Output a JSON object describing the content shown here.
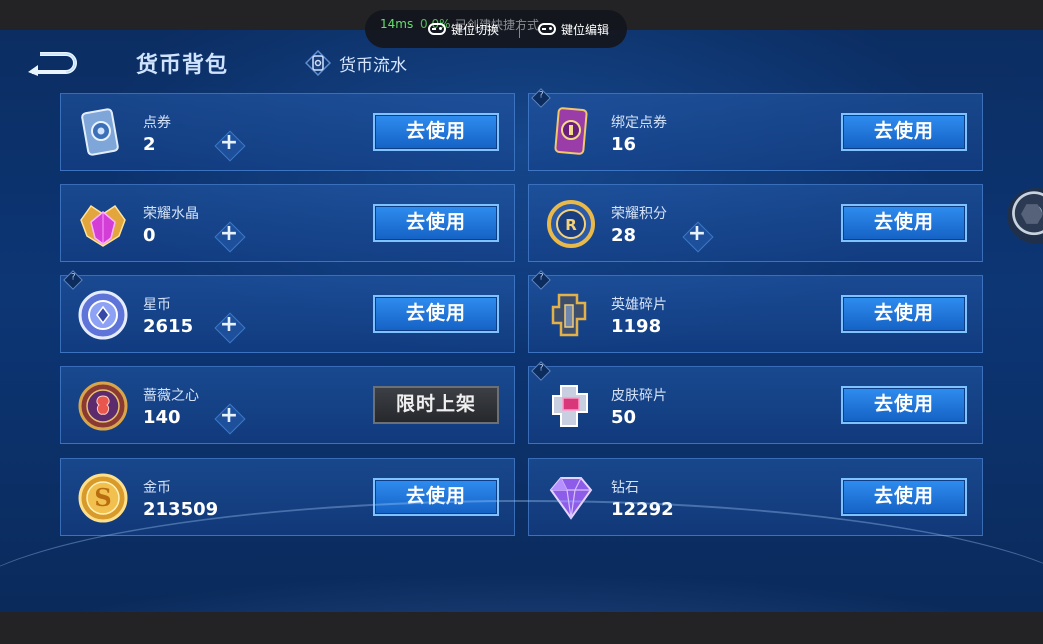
{
  "overlay": {
    "ping": "14ms",
    "loss": "0.0%",
    "hint": "已创建快捷方式",
    "switch_label": "键位切换",
    "edit_label": "键位编辑"
  },
  "header": {
    "title": "货币背包",
    "flow_tab": "货币流水"
  },
  "currencies": [
    {
      "name": "点券",
      "count": "2",
      "button": "去使用"
    },
    {
      "name": "绑定点券",
      "count": "16",
      "button": "去使用"
    },
    {
      "name": "荣耀水晶",
      "count": "0",
      "button": "去使用"
    },
    {
      "name": "荣耀积分",
      "count": "28",
      "button": "去使用"
    },
    {
      "name": "星币",
      "count": "2615",
      "button": "去使用"
    },
    {
      "name": "英雄碎片",
      "count": "1198",
      "button": "去使用"
    },
    {
      "name": "蔷薇之心",
      "count": "140",
      "button": "限时上架"
    },
    {
      "name": "皮肤碎片",
      "count": "50",
      "button": "去使用"
    },
    {
      "name": "金币",
      "count": "213509",
      "button": "去使用"
    },
    {
      "name": "钻石",
      "count": "12292",
      "button": "去使用"
    }
  ],
  "plus_symbol": "+",
  "help_symbol": "?",
  "icons": {
    "points": "voucher-card-icon",
    "bound_points": "bound-voucher-card-icon",
    "crystal": "glory-crystal-icon",
    "glory_points": "glory-points-medal-icon",
    "star_coin": "star-coin-icon",
    "hero_shard": "hero-shard-icon",
    "rose_heart": "rose-heart-icon",
    "skin_shard": "skin-shard-icon",
    "gold": "gold-coin-icon",
    "diamond": "diamond-icon"
  },
  "colors": {
    "accent_button": "#1f73d8",
    "background": "#0d3675",
    "disabled_button": "#2f3237"
  }
}
